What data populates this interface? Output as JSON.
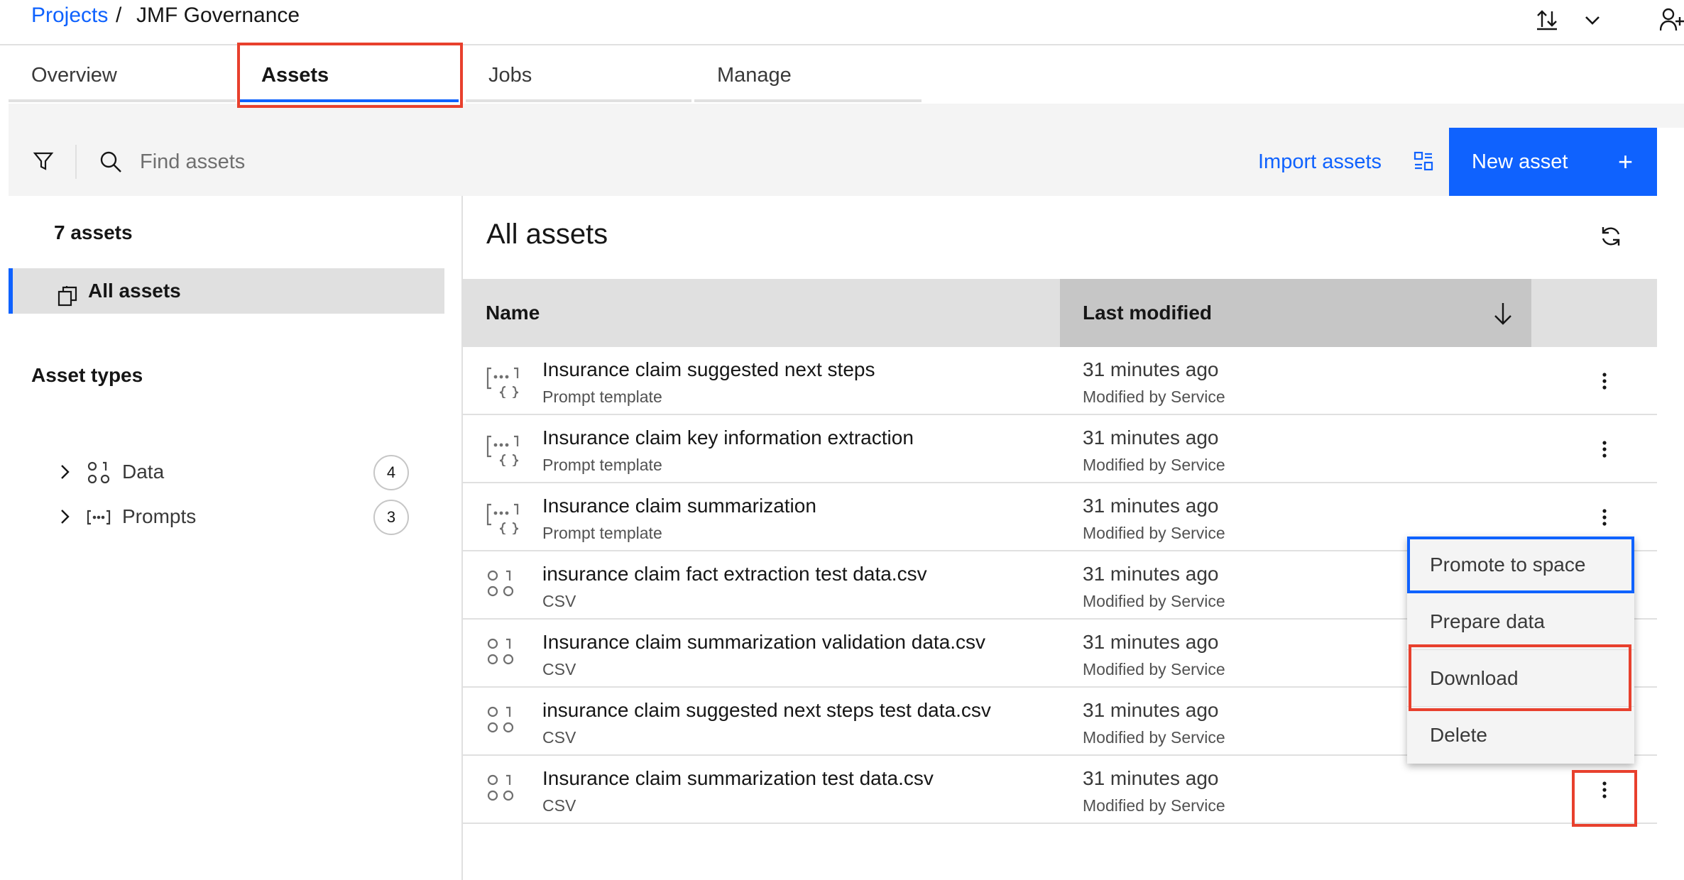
{
  "breadcrumb": {
    "parent": "Projects",
    "separator": "/",
    "current": "JMF Governance"
  },
  "tabs": [
    {
      "label": "Overview",
      "active": false
    },
    {
      "label": "Assets",
      "active": true
    },
    {
      "label": "Jobs",
      "active": false
    },
    {
      "label": "Manage",
      "active": false
    }
  ],
  "toolbar": {
    "search_placeholder": "Find assets",
    "import_label": "Import assets",
    "new_label": "New asset",
    "new_icon": "+"
  },
  "sidebar": {
    "count": "7 assets",
    "all_assets": "All assets",
    "types_title": "Asset types",
    "types": [
      {
        "label": "Data",
        "count": "4",
        "icon": "data-icon"
      },
      {
        "label": "Prompts",
        "count": "3",
        "icon": "prompt-icon"
      }
    ]
  },
  "main": {
    "title": "All assets",
    "columns": {
      "name": "Name",
      "modified": "Last modified"
    },
    "rows": [
      {
        "name": "Insurance claim suggested next steps",
        "type": "Prompt template",
        "modified": "31 minutes ago",
        "by": "Modified by Service",
        "icon": "prompt-template-icon"
      },
      {
        "name": "Insurance claim key information extraction",
        "type": "Prompt template",
        "modified": "31 minutes ago",
        "by": "Modified by Service",
        "icon": "prompt-template-icon"
      },
      {
        "name": "Insurance claim summarization",
        "type": "Prompt template",
        "modified": "31 minutes ago",
        "by": "Modified by Service",
        "icon": "prompt-template-icon"
      },
      {
        "name": "insurance claim fact extraction test data.csv",
        "type": "CSV",
        "modified": "31 minutes ago",
        "by": "Modified by Service",
        "icon": "csv-data-icon"
      },
      {
        "name": "Insurance claim summarization validation data.csv",
        "type": "CSV",
        "modified": "31 minutes ago",
        "by": "Modified by Service",
        "icon": "csv-data-icon"
      },
      {
        "name": "insurance claim suggested next steps test data.csv",
        "type": "CSV",
        "modified": "31 minutes ago",
        "by": "Modified by Service",
        "icon": "csv-data-icon"
      },
      {
        "name": "Insurance claim summarization test data.csv",
        "type": "CSV",
        "modified": "31 minutes ago",
        "by": "Modified by Service",
        "icon": "csv-data-icon"
      }
    ]
  },
  "menu": {
    "items": [
      {
        "label": "Promote to space"
      },
      {
        "label": "Prepare data"
      },
      {
        "label": "Download"
      },
      {
        "label": "Delete"
      }
    ]
  },
  "colors": {
    "accent": "#0f62fe",
    "annotation": "#e8402d"
  }
}
